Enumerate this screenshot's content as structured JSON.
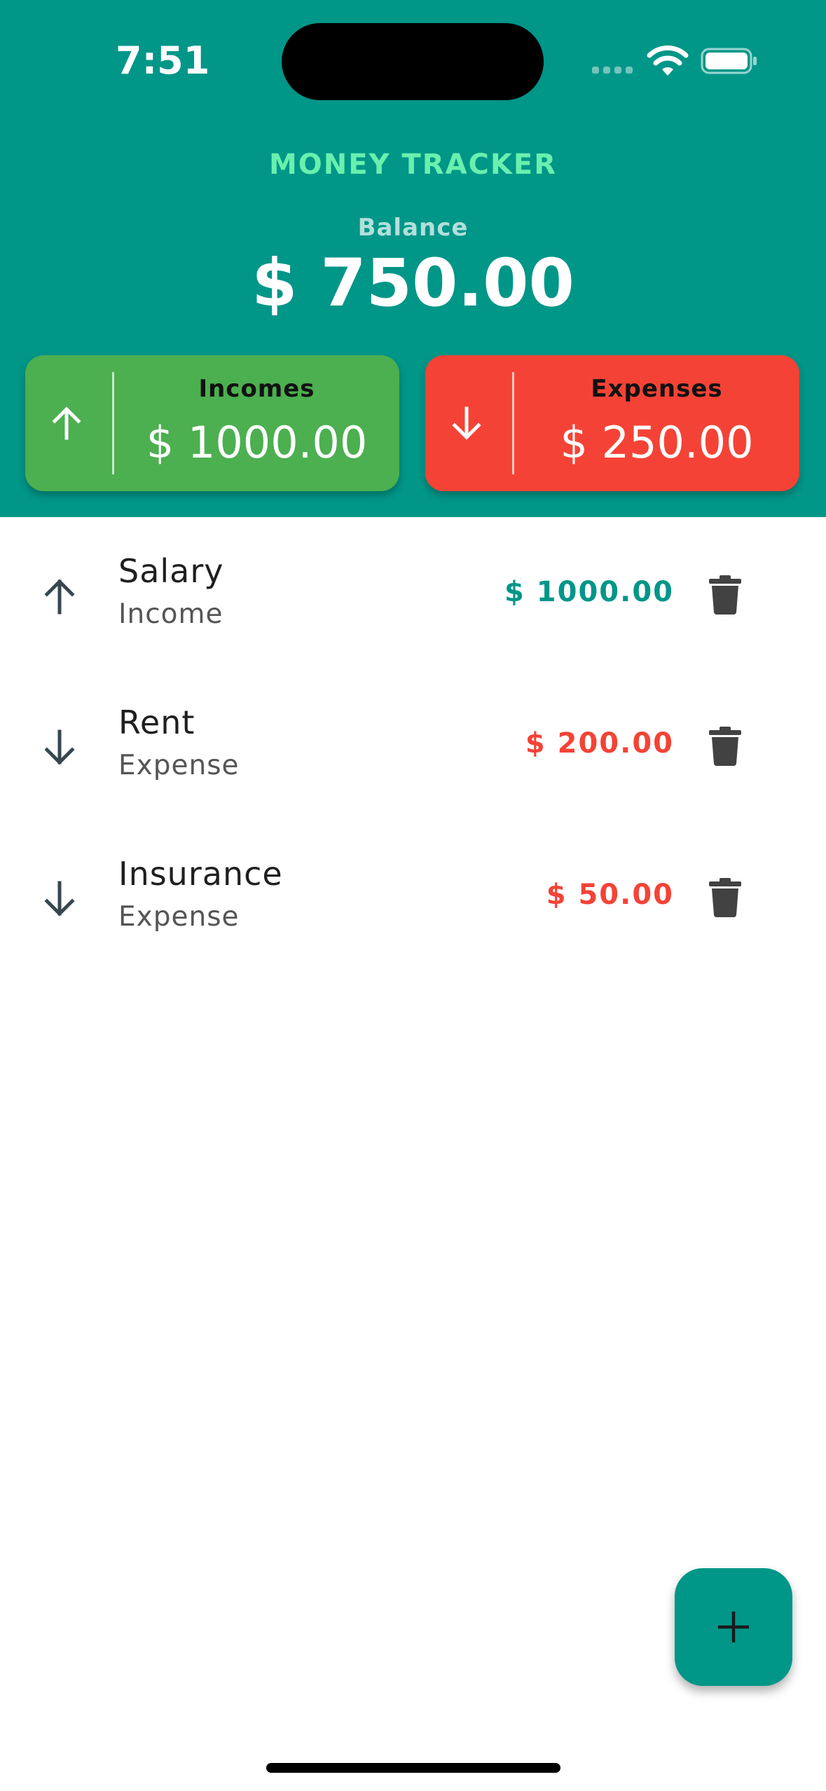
{
  "status_bar": {
    "time": "7:51"
  },
  "header": {
    "app_title": "MONEY TRACKER",
    "balance_label": "Balance",
    "balance_amount": "$ 750.00"
  },
  "summary": {
    "incomes": {
      "label": "Incomes",
      "amount": "$ 1000.00",
      "icon": "arrow-up-icon",
      "color": "#4caf50"
    },
    "expenses": {
      "label": "Expenses",
      "amount": "$ 250.00",
      "icon": "arrow-down-icon",
      "color": "#f44336"
    }
  },
  "transactions": [
    {
      "title": "Salary",
      "type": "Income",
      "amount": "$ 1000.00",
      "icon": "arrow-up-icon",
      "amount_color": "#009688"
    },
    {
      "title": "Rent",
      "type": "Expense",
      "amount": "$ 200.00",
      "icon": "arrow-down-icon",
      "amount_color": "#f44336"
    },
    {
      "title": "Insurance",
      "type": "Expense",
      "amount": "$ 50.00",
      "icon": "arrow-down-icon",
      "amount_color": "#f44336"
    }
  ],
  "colors": {
    "primary": "#009688",
    "accent": "#69f0ae",
    "income": "#4caf50",
    "expense": "#f44336"
  },
  "fab": {
    "icon": "plus-icon"
  }
}
